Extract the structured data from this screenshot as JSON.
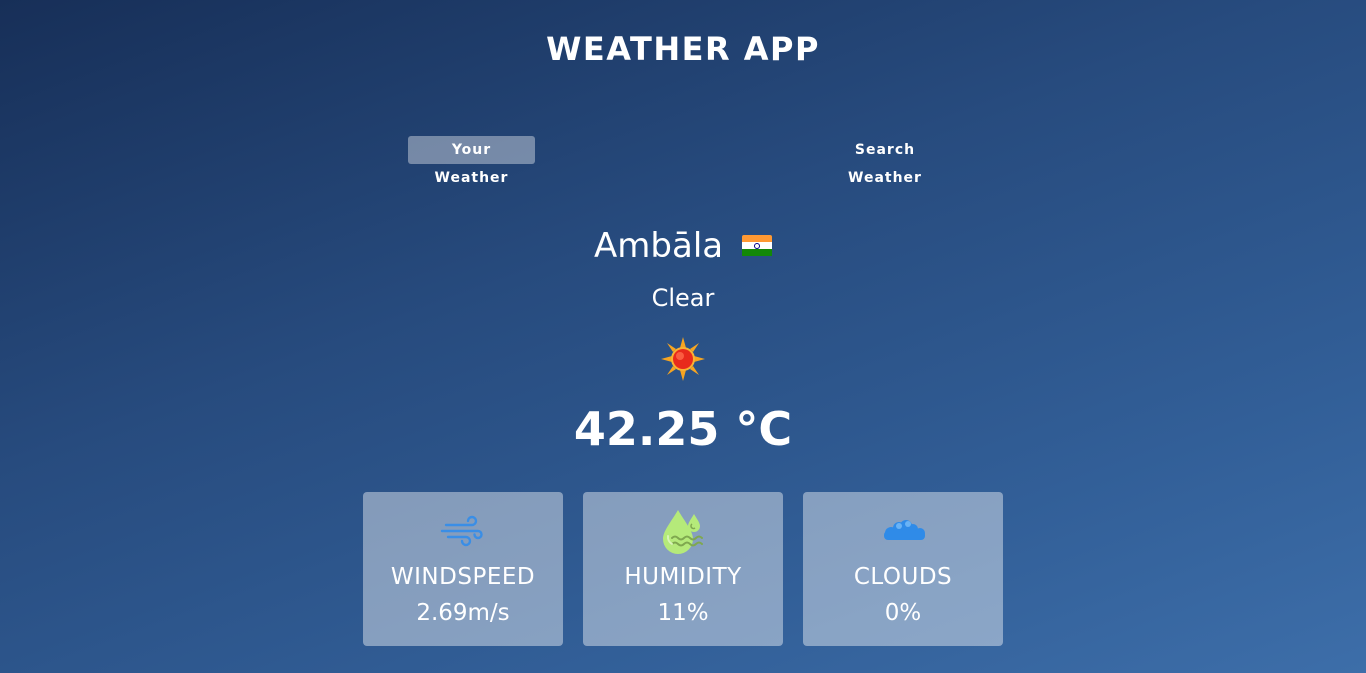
{
  "app": {
    "title": "WEATHER APP"
  },
  "tabs": [
    {
      "label": "Your Weather",
      "active": true
    },
    {
      "label": "Search Weather",
      "active": false
    }
  ],
  "weather": {
    "city": "Ambāla",
    "country_flag": "india-flag-icon",
    "condition": "Clear",
    "condition_icon": "sun-icon",
    "temperature": "42.25 °C"
  },
  "stats": {
    "windspeed": {
      "label": "WINDSPEED",
      "value": "2.69m/s",
      "icon": "wind-icon"
    },
    "humidity": {
      "label": "HUMIDITY",
      "value": "11%",
      "icon": "humidity-icon"
    },
    "clouds": {
      "label": "CLOUDS",
      "value": "0%",
      "icon": "cloud-icon"
    }
  },
  "colors": {
    "background_top": "#172f58",
    "background_bottom": "#3d6ea9",
    "wind_icon": "#3a8ee6",
    "humidity_icon": "#b5ea7a",
    "cloud_icon": "#2f8be8"
  }
}
